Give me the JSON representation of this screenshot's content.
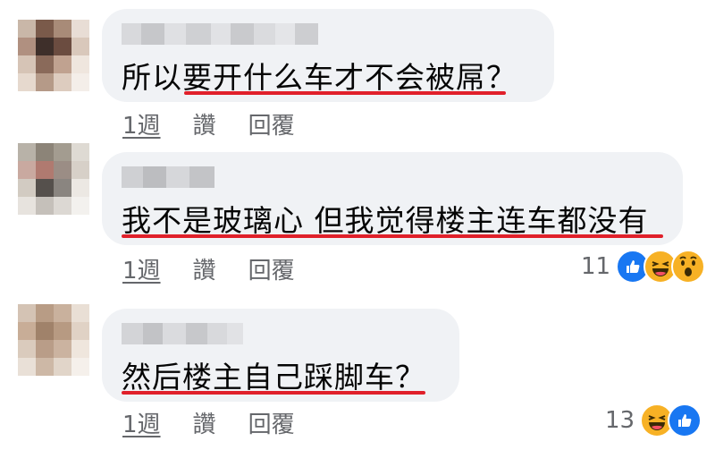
{
  "comments": [
    {
      "text": "所以要开什么车才不会被屌？",
      "time": "1週",
      "like_label": "讚",
      "reply_label": "回覆",
      "reaction_count": "",
      "reactions": []
    },
    {
      "text": "我不是玻璃心 但我觉得楼主连车都没有",
      "time": "1週",
      "like_label": "讚",
      "reply_label": "回覆",
      "reaction_count": "11",
      "reactions": [
        "like-icon",
        "haha-icon",
        "wow-icon"
      ]
    },
    {
      "text": "然后楼主自己踩脚车？",
      "time": "1週",
      "like_label": "讚",
      "reply_label": "回覆",
      "reaction_count": "13",
      "reactions": [
        "haha-icon",
        "like-icon"
      ]
    }
  ],
  "colors": {
    "bubble": "#f0f2f5",
    "underline": "#e0202a",
    "meta_text": "#65676b",
    "like_blue": "#1877f2",
    "haha_yellow": "#f7b125"
  }
}
